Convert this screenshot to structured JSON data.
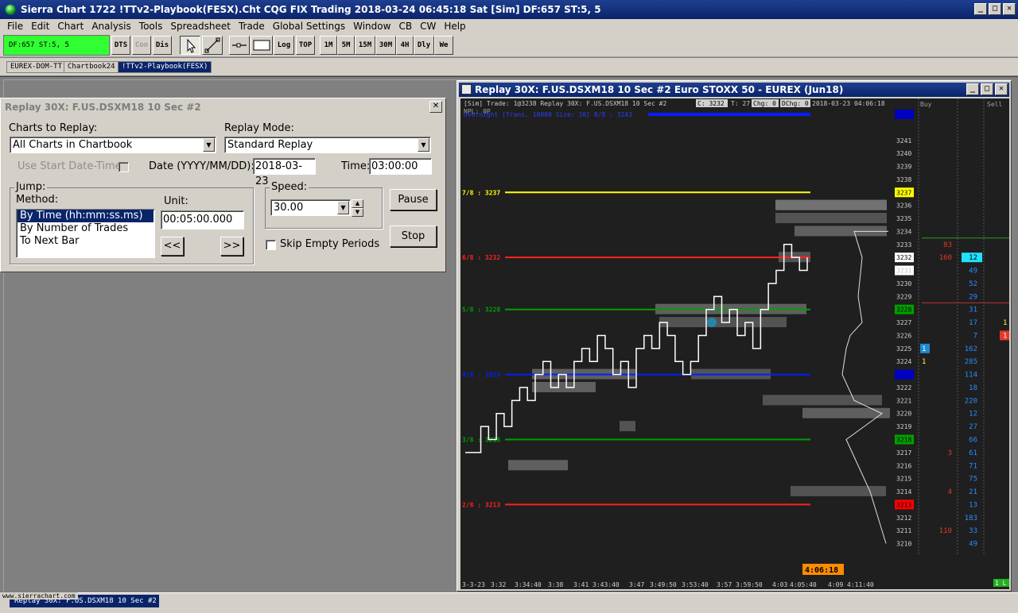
{
  "window": {
    "title": "Sierra Chart 1722 !TTv2-Playbook(FESX).Cht  CQG FIX Trading 2018-03-24  06:45:18 Sat [Sim]  DF:657  ST:5, 5",
    "min": "_",
    "max": "□",
    "close": "✕"
  },
  "menu": [
    "File",
    "Edit",
    "Chart",
    "Analysis",
    "Tools",
    "Spreadsheet",
    "Trade",
    "Global Settings",
    "Window",
    "CB",
    "CW",
    "Help"
  ],
  "toolbar": {
    "status": "DF:657  ST:5, 5",
    "buttons": [
      "DTS",
      "Con",
      "Dis",
      "Log",
      "TOP",
      "1M",
      "5M",
      "15M",
      "30M",
      "4H",
      "Dly",
      "We"
    ]
  },
  "chartbook_tabs": [
    "EUREX-DOM-TT",
    "Chartbook24",
    "!TTv2-Playbook(FESX)"
  ],
  "replay_dialog": {
    "title": "Replay 30X: F.US.DSXM18  10 Sec  #2",
    "close": "✕",
    "charts_to_replay_label": "Charts to Replay:",
    "charts_to_replay_value": "All Charts in Chartbook",
    "replay_mode_label": "Replay Mode:",
    "replay_mode_value": "Standard Replay",
    "use_start_label": "Use Start Date-Time",
    "date_label": "Date (YYYY/MM/DD):",
    "date_value": "2018-03-23",
    "time_label": "Time:",
    "time_value": "03:00:00",
    "jump_label": "Jump:",
    "method_label": "Method:",
    "methods": [
      "By Time (hh:mm:ss.ms)",
      "By Number of Trades",
      "To Next Bar"
    ],
    "unit_label": "Unit:",
    "unit_value": "00:05:00.000",
    "back_btn": "<<",
    "fwd_btn": ">>",
    "speed_label": "Speed:",
    "speed_value": "30.00",
    "skip_label": "Skip Empty Periods",
    "pause_btn": "Pause",
    "stop_btn": "Stop"
  },
  "chart_window": {
    "title": "Replay 30X: F.US.DSXM18  10 Sec  #2  Euro STOXX 50 - EUREX (Jun18)",
    "min": "_",
    "max": "□",
    "close": "✕",
    "info_bar": "[Sim]  Trade: 1@3238  Replay 30X: F.US.DSXM18  10 Sec    #2",
    "info_c": "C: 3232",
    "info_t": "T: 27",
    "info_chg": "Chg: 0",
    "info_dchg": "DChg: 0",
    "info_dt": "2018-03-23 04:06:18",
    "npl": "NPL: 0P",
    "overnight": "Overnight [Trans. 10000 Size: 10] 8/8 : 3243",
    "levels": [
      {
        "label": "7/8 : 3237",
        "color": "#ffff00"
      },
      {
        "label": "6/8 : 3232",
        "color": "#ff2020"
      },
      {
        "label": "5/8 : 3228",
        "color": "#00a000"
      },
      {
        "label": "4/8 : 3223",
        "color": "#0020ff"
      },
      {
        "label": "3/8 : 3218",
        "color": "#00a000"
      },
      {
        "label": "2/8 : 3213",
        "color": "#ff2020"
      }
    ],
    "time_label": "4:06:18",
    "x_labels": [
      "3-3-23",
      "3:32",
      "3:34:40",
      "3:38",
      "3:41",
      "3:43:40",
      "3:47",
      "3:49:50",
      "3:53:40",
      "3:57",
      "3:59:50",
      "4:03",
      "4:05:40",
      "4:09",
      "4:11:40"
    ],
    "dom_headers": {
      "buy": "Buy",
      "sell": "Sell"
    },
    "pl_indicator": "1  L",
    "price_scale": [
      {
        "p": "3243",
        "bg": "#0000c0",
        "fg": "#0000c0"
      },
      {
        "p": "3241"
      },
      {
        "p": "3240"
      },
      {
        "p": "3239"
      },
      {
        "p": "3238"
      },
      {
        "p": "3237",
        "bg": "#ffff00",
        "fg": "#000000"
      },
      {
        "p": "3236"
      },
      {
        "p": "3235"
      },
      {
        "p": "3234"
      },
      {
        "p": "3233"
      },
      {
        "p": "3232",
        "bg": "#ffffff",
        "fg": "#000000"
      },
      {
        "p": "3231",
        "bg": "#ffffff",
        "fg": "#c0c0c0"
      },
      {
        "p": "3230"
      },
      {
        "p": "3229"
      },
      {
        "p": "3228",
        "bg": "#00a000",
        "fg": "#000000"
      },
      {
        "p": "3227"
      },
      {
        "p": "3226"
      },
      {
        "p": "3225"
      },
      {
        "p": "3224"
      },
      {
        "p": "3223",
        "bg": "#0000c0",
        "fg": "#0000c0"
      },
      {
        "p": "3222"
      },
      {
        "p": "3221"
      },
      {
        "p": "3220"
      },
      {
        "p": "3219"
      },
      {
        "p": "3218",
        "bg": "#00a000",
        "fg": "#000000"
      },
      {
        "p": "3217"
      },
      {
        "p": "3216"
      },
      {
        "p": "3215"
      },
      {
        "p": "3214"
      },
      {
        "p": "3213",
        "bg": "#ff0000",
        "fg": "#000000"
      },
      {
        "p": "3212"
      },
      {
        "p": "3211"
      },
      {
        "p": "3210"
      }
    ],
    "dom_rows": [
      {
        "price": "3233",
        "bid": "",
        "ask": "83",
        "vol": "",
        "sell": ""
      },
      {
        "price": "3232",
        "bid": "",
        "ask": "160",
        "vol": "12",
        "sell": "",
        "volhl": true
      },
      {
        "price": "3231",
        "bid": "",
        "ask": "",
        "vol": "49",
        "sell": ""
      },
      {
        "price": "3230",
        "bid": "",
        "ask": "",
        "vol": "52",
        "sell": ""
      },
      {
        "price": "3229",
        "bid": "",
        "ask": "",
        "vol": "29",
        "sell": ""
      },
      {
        "price": "3228",
        "bid": "",
        "ask": "",
        "vol": "31",
        "sell": ""
      },
      {
        "price": "3227",
        "bid": "",
        "ask": "",
        "vol": "17",
        "sell": "1"
      },
      {
        "price": "3226",
        "bid": "",
        "ask": "",
        "vol": "7",
        "sell": "1",
        "sellhl": true
      },
      {
        "price": "3225",
        "bid": "1",
        "ask": "",
        "vol": "162",
        "sell": "",
        "bidhl": true
      },
      {
        "price": "3224",
        "bid": "1",
        "ask": "",
        "vol": "285",
        "sell": ""
      },
      {
        "price": "3223",
        "bid": "",
        "ask": "",
        "vol": "114",
        "sell": ""
      },
      {
        "price": "3222",
        "bid": "",
        "ask": "",
        "vol": "18",
        "sell": ""
      },
      {
        "price": "3221",
        "bid": "",
        "ask": "",
        "vol": "220",
        "sell": ""
      },
      {
        "price": "3220",
        "bid": "",
        "ask": "",
        "vol": "12",
        "sell": ""
      },
      {
        "price": "3219",
        "bid": "",
        "ask": "",
        "vol": "27",
        "sell": ""
      },
      {
        "price": "3218",
        "bid": "",
        "ask": "",
        "vol": "66",
        "sell": ""
      },
      {
        "price": "3217",
        "bid": "",
        "ask": "3",
        "vol": "61",
        "sell": ""
      },
      {
        "price": "3216",
        "bid": "",
        "ask": "",
        "vol": "71",
        "sell": ""
      },
      {
        "price": "3215",
        "bid": "",
        "ask": "",
        "vol": "75",
        "sell": ""
      },
      {
        "price": "3214",
        "bid": "",
        "ask": "4",
        "vol": "21",
        "sell": ""
      },
      {
        "price": "3213",
        "bid": "",
        "ask": "",
        "vol": "13",
        "sell": ""
      },
      {
        "price": "3212",
        "bid": "",
        "ask": "",
        "vol": "183",
        "sell": ""
      },
      {
        "price": "3211",
        "bid": "",
        "ask": "110",
        "vol": "33",
        "sell": ""
      },
      {
        "price": "3210",
        "bid": "",
        "ask": "",
        "vol": "49",
        "sell": ""
      }
    ]
  },
  "taskbar": {
    "minimized": "Replay 30X: F.US.DSXM18  10 Sec  #2",
    "watermark": "www.sierrachart.com"
  }
}
